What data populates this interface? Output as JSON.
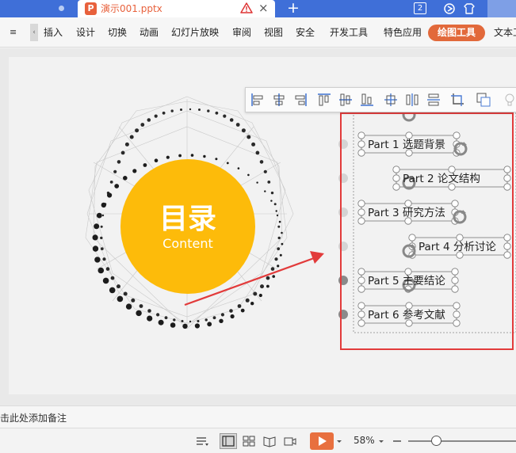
{
  "titlebar": {
    "doc_icon_letter": "P",
    "doc_tab_name": "演示001.pptx",
    "close_glyph": "×",
    "new_tab_glyph": "+",
    "window_count": "2"
  },
  "ribbon": {
    "menu_glyph": "≡",
    "collapse_glyph": "‹",
    "items": [
      "插入",
      "设计",
      "切换",
      "动画",
      "幻灯片放映",
      "审阅",
      "视图",
      "安全",
      "开发工具",
      "特色应用"
    ],
    "active_tab": "绘图工具",
    "trailing_tab": "文本工"
  },
  "slide": {
    "circle_title": "目录",
    "circle_subtitle": "Content",
    "toc_items": [
      {
        "num": "Part 1",
        "title": "选题背景"
      },
      {
        "num": "Part 2",
        "title": "论文结构"
      },
      {
        "num": "Part 3",
        "title": "研究方法"
      },
      {
        "num": "Part 4",
        "title": "分析讨论"
      },
      {
        "num": "Part 5",
        "title": "主要结论"
      },
      {
        "num": "Part 6",
        "title": "参考文献"
      }
    ],
    "colors": {
      "circle": "#fdbb0a",
      "selection_box": "#e23b3b",
      "arrow": "#e23b3b",
      "dot_light": "#d4d4d4",
      "dot_dark": "#8a8a8a"
    }
  },
  "align_toolbar": {
    "icons": [
      "align-left-icon",
      "align-center-horizontal-icon",
      "align-right-icon",
      "align-top-icon",
      "align-middle-icon",
      "align-bottom-icon",
      "distribute-center-icon",
      "distribute-horizontal-icon",
      "distribute-vertical-icon",
      "crop-icon",
      "group-icon",
      "bulb-icon"
    ]
  },
  "notes": {
    "placeholder": "击此处添加备注"
  },
  "statusbar": {
    "zoom": "58%",
    "zoom_level": 0.58
  }
}
